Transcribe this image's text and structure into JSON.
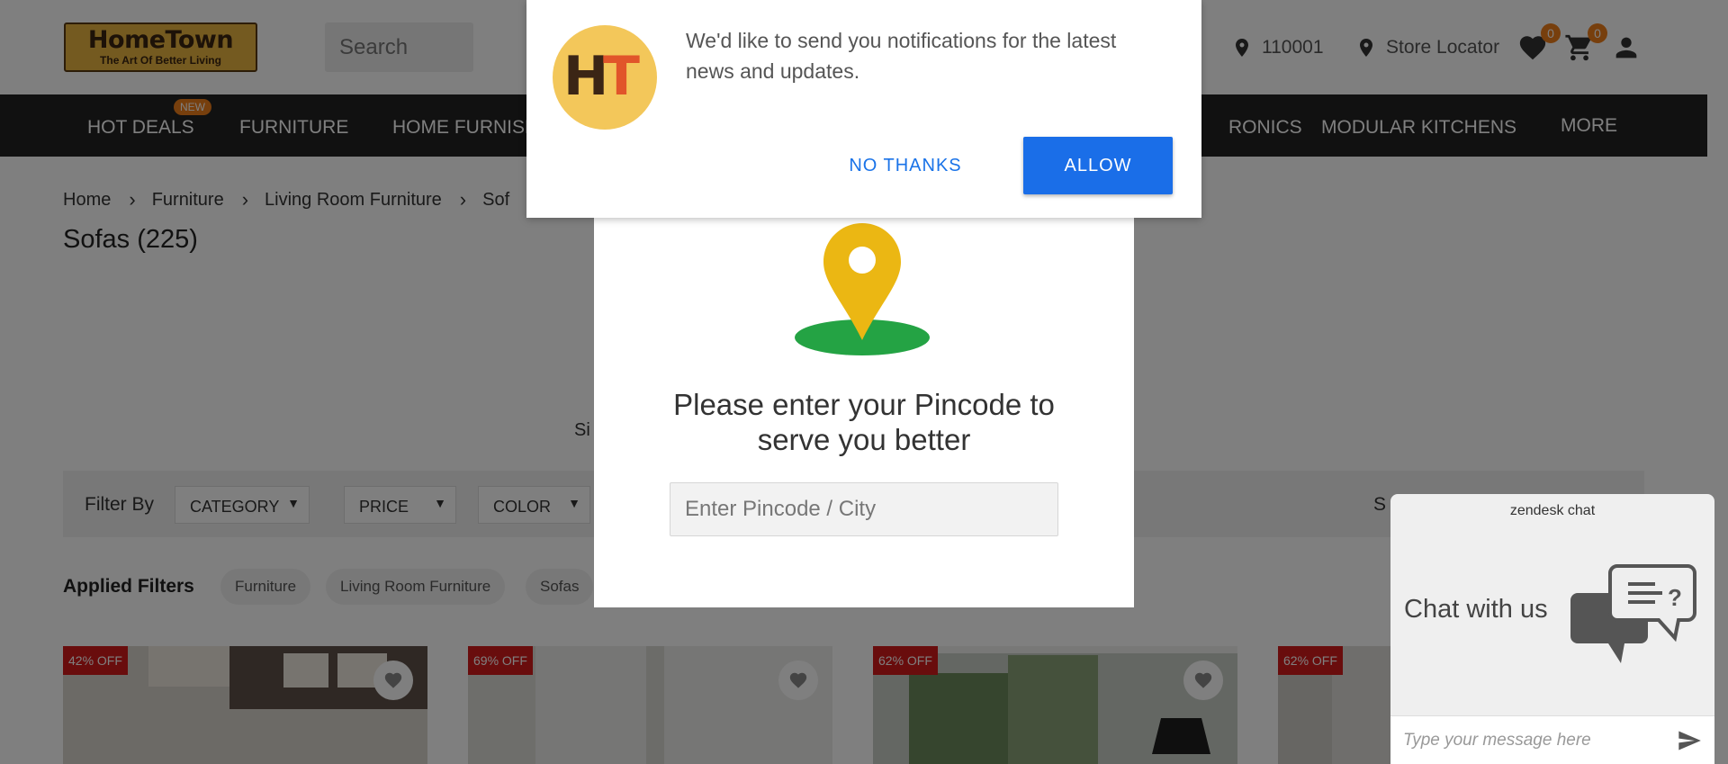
{
  "header": {
    "logo_main": "HomeTown",
    "logo_tagline": "The Art Of Better Living",
    "search_placeholder": "Search",
    "pincode": "110001",
    "store_locator": "Store Locator",
    "wishlist_count": "0",
    "cart_count": "0"
  },
  "nav": {
    "items": [
      "HOT DEALS",
      "FURNITURE",
      "HOME FURNISH",
      "RONICS",
      "MODULAR KITCHENS",
      "MORE"
    ],
    "new_badge": "NEW"
  },
  "breadcrumb": [
    "Home",
    "Furniture",
    "Living Room Furniture",
    "Sof"
  ],
  "page_title": "Sofas (225)",
  "partial_text": "Si",
  "filters": {
    "label": "Filter By",
    "dropdowns": [
      "CATEGORY",
      "PRICE",
      "COLOR"
    ],
    "sort_partial": "S"
  },
  "applied_filters": {
    "label": "Applied Filters",
    "chips": [
      "Furniture",
      "Living Room Furniture",
      "Sofas"
    ]
  },
  "products": [
    {
      "discount": "42% OFF"
    },
    {
      "discount": "69% OFF"
    },
    {
      "discount": "62% OFF"
    },
    {
      "discount": "62% OFF"
    }
  ],
  "notification": {
    "message": "We'd like to send you notifications for the latest news and updates.",
    "logo_letters": [
      "H",
      "T"
    ],
    "no_thanks": "NO THANKS",
    "allow": "ALLOW"
  },
  "pincode_modal": {
    "heading_line1": "Please enter your Pincode to",
    "heading_line2": "serve you better",
    "input_placeholder": "Enter Pincode / City"
  },
  "chat": {
    "brand": "zendesk chat",
    "title": "Chat with us",
    "input_placeholder": "Type your message here"
  },
  "colors": {
    "accent_orange": "#ef7e1a",
    "nav_bg": "#222222",
    "allow_blue": "#1a6ee8",
    "pin_yellow": "#ebb713",
    "pin_green": "#24a344",
    "discount_red": "#d21b1b"
  }
}
